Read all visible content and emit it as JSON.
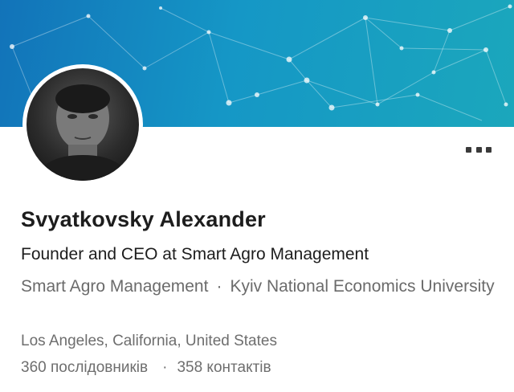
{
  "profile": {
    "name": "Svyatkovsky Alexander",
    "headline": "Founder and CEO at Smart Agro Management",
    "company": "Smart Agro Management",
    "separator": "·",
    "education": "Kyiv National Economics University",
    "location": "Los Angeles, California, United States",
    "followers": "360 послідовників",
    "connections": "358 контактів"
  },
  "icons": {
    "more": "more-horizontal-icon"
  },
  "colors": {
    "banner_start": "#1273b9",
    "banner_end": "#1ba7bc",
    "name_text": "#1d1d1d",
    "secondary_text": "#6b6b6b"
  }
}
